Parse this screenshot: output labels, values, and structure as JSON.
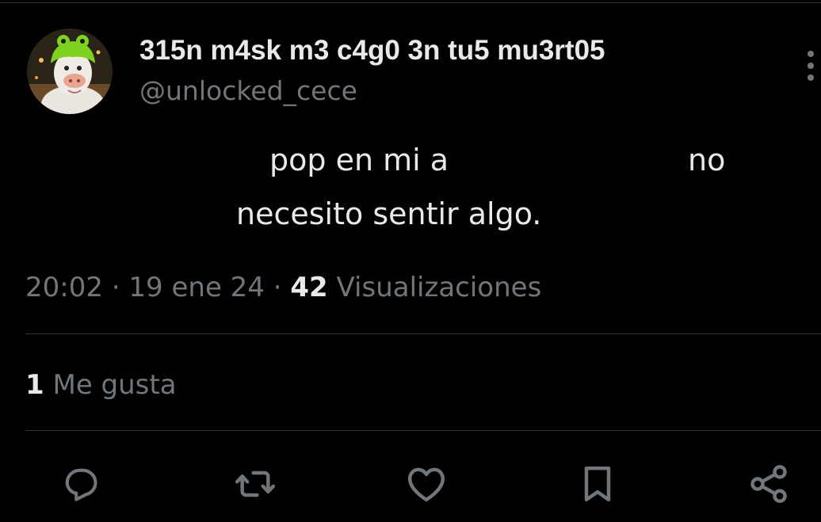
{
  "theme": {
    "background": "#000000",
    "text_primary": "#e7e9ea",
    "text_secondary": "#71767b",
    "divider": "#2f3336"
  },
  "author": {
    "display_name": "315n m4sk m3 c4g0 3n tu5 mu3rt05",
    "handle": "@unlocked_cece",
    "avatar_icon": "avatar-frog-hat-character"
  },
  "tweet": {
    "text_line_1a": "pop en mi   a",
    "text_line_1b": "no",
    "text_line_2": "necesito sentir algo."
  },
  "meta": {
    "time": "20:02",
    "separator": "·",
    "date": "19 ene 24",
    "views_count": "42",
    "views_label": "Visualizaciones"
  },
  "stats": {
    "likes_count": "1",
    "likes_label": "Me gusta"
  },
  "actions": {
    "reply_icon": "reply-icon",
    "retweet_icon": "retweet-icon",
    "like_icon": "heart-icon",
    "bookmark_icon": "bookmark-icon",
    "share_icon": "share-icon",
    "more_icon": "more-vertical-icon"
  }
}
